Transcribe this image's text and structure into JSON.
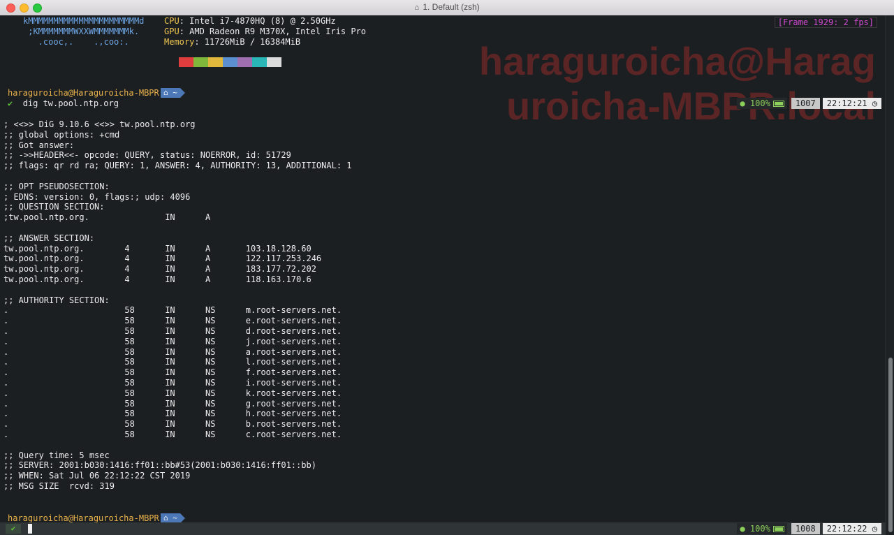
{
  "window": {
    "title": "1. Default (zsh)",
    "title_icon": "home-icon"
  },
  "overlay": {
    "frame": "[Frame 1929: 2 fps]",
    "hostname_line1": "haraguroicha@Harag",
    "hostname_line2": "uroicha-MBPR.local"
  },
  "neofetch": {
    "art": [
      "kMMMMMMMMMMMMMMMMMMMMMMd",
      " ;KMMMMMMMWXXWMMMMMMMk.",
      "   .cooc,.    .,coo:."
    ],
    "cpu_label": "CPU",
    "cpu": ": Intel i7-4870HQ (8) @ 2.50GHz",
    "gpu_label": "GPU",
    "gpu": ": AMD Radeon R9 M370X, Intel Iris Pro",
    "mem_label": "Memory",
    "mem": ": 11726MiB / 16384MiB",
    "palette": [
      "#e03e3e",
      "#7fb83a",
      "#e1b73c",
      "#5b8fd0",
      "#a06fb0",
      "#2ab6b6",
      "#dcdcdc"
    ]
  },
  "prompt1": {
    "user": "haraguroicha@Haraguroicha-MBPR",
    "path": "~",
    "command": "dig tw.pool.ntp.org",
    "status_pct": "100%",
    "hist": "1007",
    "time": "22:12:21"
  },
  "output": [
    "; <<>> DiG 9.10.6 <<>> tw.pool.ntp.org",
    ";; global options: +cmd",
    ";; Got answer:",
    ";; ->>HEADER<<- opcode: QUERY, status: NOERROR, id: 51729",
    ";; flags: qr rd ra; QUERY: 1, ANSWER: 4, AUTHORITY: 13, ADDITIONAL: 1",
    "",
    ";; OPT PSEUDOSECTION:",
    "; EDNS: version: 0, flags:; udp: 4096",
    ";; QUESTION SECTION:",
    ";tw.pool.ntp.org.               IN      A",
    "",
    ";; ANSWER SECTION:",
    "tw.pool.ntp.org.        4       IN      A       103.18.128.60",
    "tw.pool.ntp.org.        4       IN      A       122.117.253.246",
    "tw.pool.ntp.org.        4       IN      A       183.177.72.202",
    "tw.pool.ntp.org.        4       IN      A       118.163.170.6",
    "",
    ";; AUTHORITY SECTION:",
    ".                       58      IN      NS      m.root-servers.net.",
    ".                       58      IN      NS      e.root-servers.net.",
    ".                       58      IN      NS      d.root-servers.net.",
    ".                       58      IN      NS      j.root-servers.net.",
    ".                       58      IN      NS      a.root-servers.net.",
    ".                       58      IN      NS      l.root-servers.net.",
    ".                       58      IN      NS      f.root-servers.net.",
    ".                       58      IN      NS      i.root-servers.net.",
    ".                       58      IN      NS      k.root-servers.net.",
    ".                       58      IN      NS      g.root-servers.net.",
    ".                       58      IN      NS      h.root-servers.net.",
    ".                       58      IN      NS      b.root-servers.net.",
    ".                       58      IN      NS      c.root-servers.net.",
    "",
    ";; Query time: 5 msec",
    ";; SERVER: 2001:b030:1416:ff01::bb#53(2001:b030:1416:ff01::bb)",
    ";; WHEN: Sat Jul 06 22:12:22 CST 2019",
    ";; MSG SIZE  rcvd: 319"
  ],
  "prompt2": {
    "user": "haraguroicha@Haraguroicha-MBPR",
    "path": "~",
    "status_pct": "100%",
    "hist": "1008",
    "time": "22:12:22"
  }
}
